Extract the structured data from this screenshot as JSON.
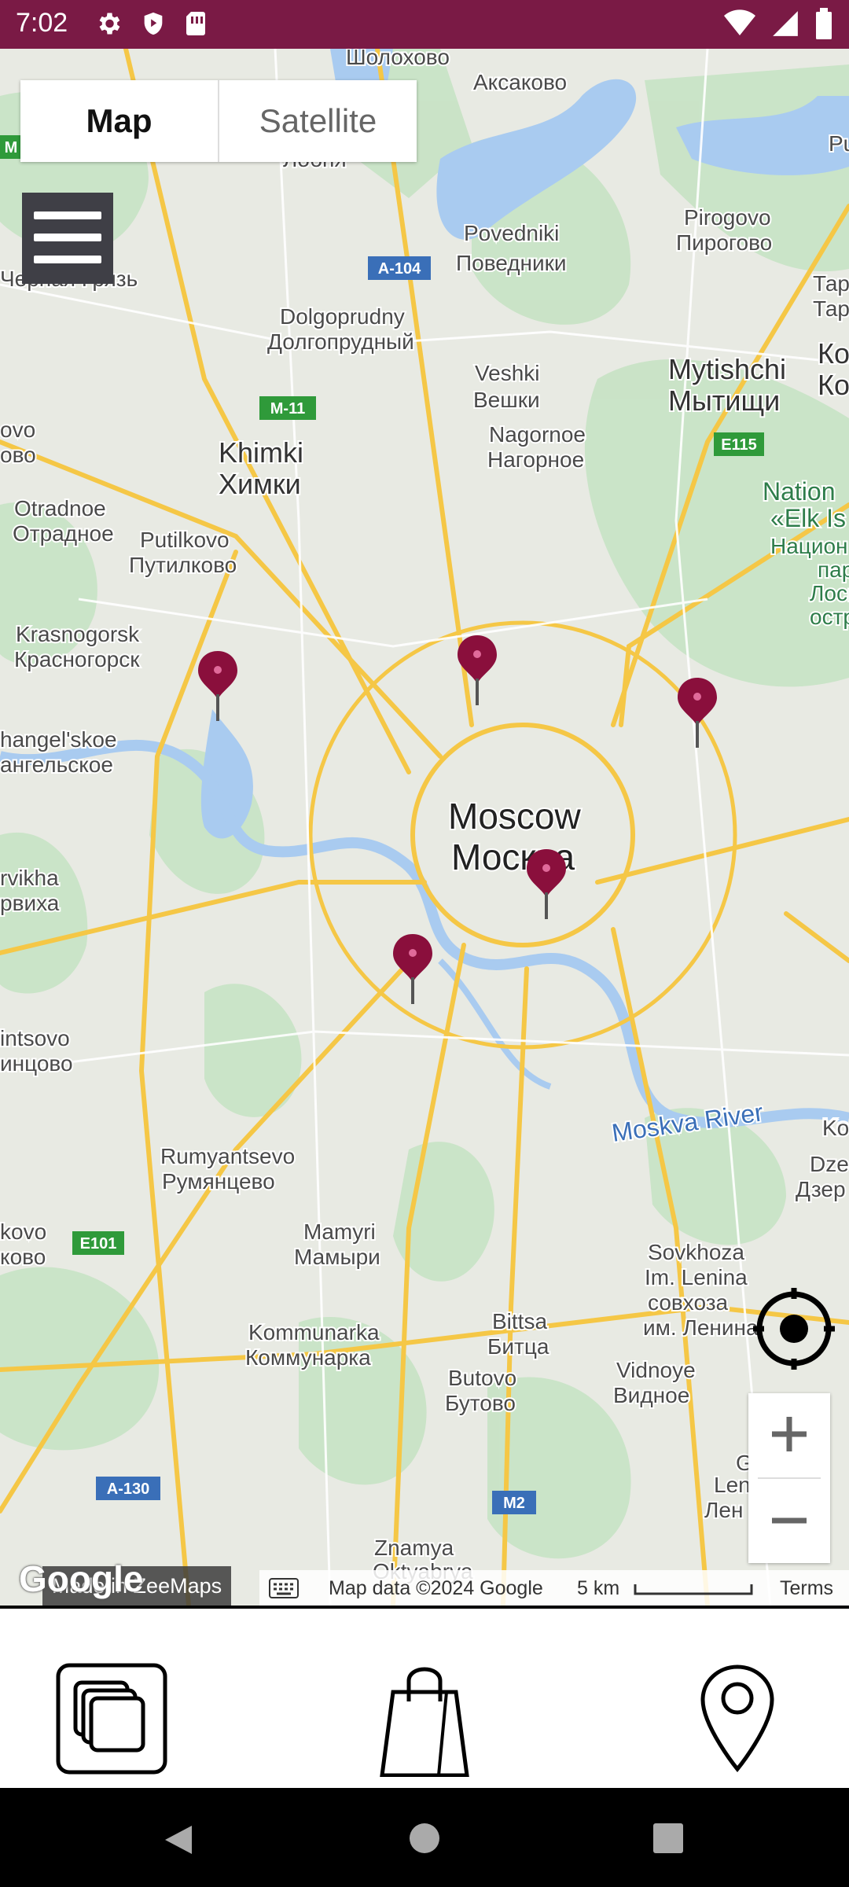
{
  "status_bar": {
    "time": "7:02",
    "left_icons": [
      "gear-icon",
      "shield-play-icon",
      "sim-card-icon"
    ],
    "right_icons": [
      "wifi-icon",
      "signal-icon",
      "battery-icon"
    ],
    "background": "#7a1a45"
  },
  "map": {
    "map_type": {
      "map_label": "Map",
      "satellite_label": "Satellite",
      "selected": "Map"
    },
    "city_label_en": "Moscow",
    "city_label_ru": "Москва",
    "river_label": "Moskva River",
    "labels": [
      {
        "text": "Шолохово"
      },
      {
        "text": "Аксаково"
      },
      {
        "text": "Лобня"
      },
      {
        "text": "Povedniki"
      },
      {
        "text": "Поведники"
      },
      {
        "text": "Pirogovo"
      },
      {
        "text": "Пирогово"
      },
      {
        "text": "Тарасо"
      },
      {
        "text": "Тарасо"
      },
      {
        "text": "Черная Грязь"
      },
      {
        "text": "Dolgoprudny"
      },
      {
        "text": "Долгопрудный"
      },
      {
        "text": "Veshki"
      },
      {
        "text": "Вешки"
      },
      {
        "text": "Mytishchi"
      },
      {
        "text": "Мытищи"
      },
      {
        "text": "Ко"
      },
      {
        "text": "Ко"
      },
      {
        "text": "Nagornoe"
      },
      {
        "text": "Нагорное"
      },
      {
        "text": "Khimki"
      },
      {
        "text": "Химки"
      },
      {
        "text": "ovo"
      },
      {
        "text": "ово"
      },
      {
        "text": "Otradnoe"
      },
      {
        "text": "Отрадное"
      },
      {
        "text": "Putilkovo"
      },
      {
        "text": "Путилково"
      },
      {
        "text": "Nation"
      },
      {
        "text": "«Elk Is"
      },
      {
        "text": "Национ"
      },
      {
        "text": "пар"
      },
      {
        "text": "Лоси"
      },
      {
        "text": "остр"
      },
      {
        "text": "Krasnogorsk"
      },
      {
        "text": "Красногорск"
      },
      {
        "text": "hangel'skoe"
      },
      {
        "text": "ангельское"
      },
      {
        "text": "rvikha"
      },
      {
        "text": "рвиха"
      },
      {
        "text": "intsovo"
      },
      {
        "text": "инцово"
      },
      {
        "text": "Rumyantsevo"
      },
      {
        "text": "Румянцево"
      },
      {
        "text": "Mamyri"
      },
      {
        "text": "Мамыри"
      },
      {
        "text": "kovo"
      },
      {
        "text": "ково"
      },
      {
        "text": "Sovkhoza"
      },
      {
        "text": "Im. Lenina"
      },
      {
        "text": "совхоза"
      },
      {
        "text": "им. Ленина"
      },
      {
        "text": "Kommunarka"
      },
      {
        "text": "Коммунарка"
      },
      {
        "text": "Bittsa"
      },
      {
        "text": "Битца"
      },
      {
        "text": "Vidnoye"
      },
      {
        "text": "Видное"
      },
      {
        "text": "Butovo"
      },
      {
        "text": "Бутово"
      },
      {
        "text": "Ko"
      },
      {
        "text": "Dze"
      },
      {
        "text": "Дзер"
      },
      {
        "text": "Len"
      },
      {
        "text": "Лен"
      },
      {
        "text": "G"
      },
      {
        "text": "Znamya"
      },
      {
        "text": "Oktyabrya"
      },
      {
        "text": "Pu"
      },
      {
        "text": "Ko"
      }
    ],
    "highway_shields": [
      "A-104",
      "M-11",
      "E115",
      "E101",
      "A-130",
      "M2",
      "M"
    ],
    "pins_count": 5,
    "attribution": {
      "google": "Google",
      "made_in": "Made in ZeeMaps",
      "map_data": "Map data ©2024 Google",
      "scale": "5 km",
      "terms": "Terms"
    },
    "controls": {
      "zoom_in": "+",
      "zoom_out": "−"
    },
    "pin_color": "#8a0f3c"
  },
  "bottom_nav": {
    "items": [
      {
        "icon": "layers-icon"
      },
      {
        "icon": "shopping-bag-icon"
      },
      {
        "icon": "location-pin-icon"
      }
    ]
  },
  "system_nav": {
    "icons": [
      "back-icon",
      "home-icon",
      "recents-icon"
    ]
  }
}
